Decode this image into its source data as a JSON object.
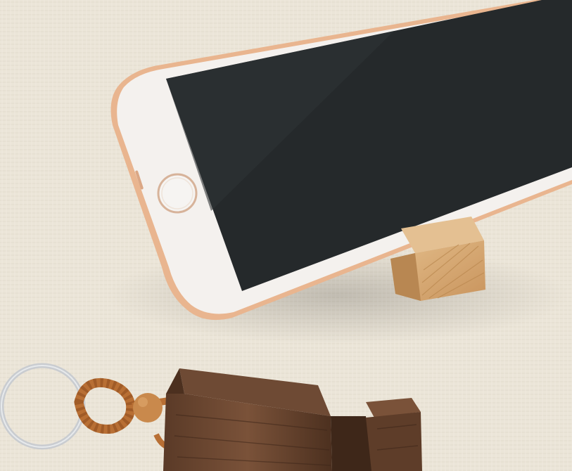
{
  "scene": {
    "description_free": true,
    "colors": {
      "fabric": "#ebe5d8",
      "fabric_shadow": "#d9d1c0",
      "phone_frame": "#f4f1ee",
      "phone_rim": "#e9b58f",
      "screen": "#25292b",
      "home_ring": "#d7b39a",
      "light_wood": "#d8ad78",
      "light_wood_dark": "#b88752",
      "walnut": "#6a4631",
      "walnut_dark": "#3e2719",
      "cord": "#b86f34",
      "key_ring": "#cfd2d5"
    },
    "objects": [
      {
        "id": "smartphone",
        "icon": "phone-icon"
      },
      {
        "id": "cube-stand",
        "icon": "wood-cube-icon"
      },
      {
        "id": "walnut-keychain-stand",
        "icon": "keychain-icon"
      },
      {
        "id": "key-ring",
        "icon": "ring-icon"
      }
    ]
  }
}
